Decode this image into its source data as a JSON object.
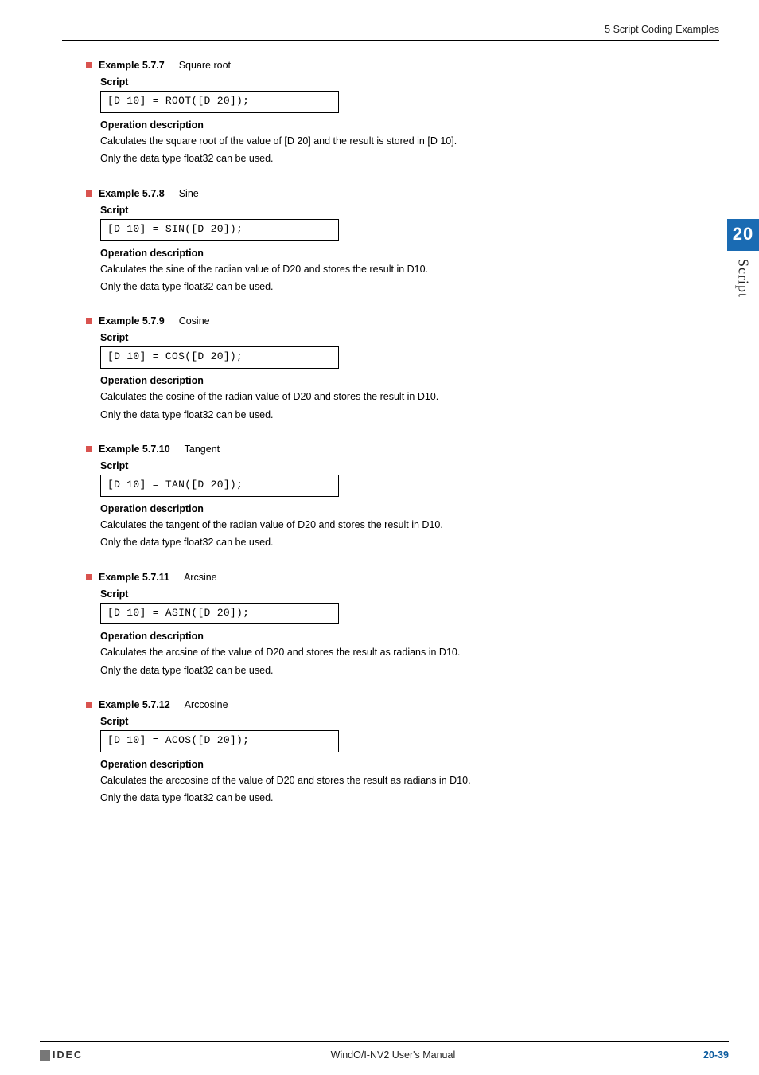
{
  "header": {
    "section": "5 Script Coding Examples"
  },
  "side": {
    "number": "20",
    "label": "Script"
  },
  "examples": [
    {
      "label": "Example 5.7.7",
      "title": "Square root",
      "script_heading": "Script",
      "script": "[D 10] = ROOT([D 20]);",
      "opdesc_heading": "Operation description",
      "desc1": "Calculates the square root of the value of [D 20] and the result is stored in [D 10].",
      "desc2": "Only the data type float32 can be used."
    },
    {
      "label": "Example 5.7.8",
      "title": "Sine",
      "script_heading": "Script",
      "script": "[D 10] = SIN([D 20]);",
      "opdesc_heading": "Operation description",
      "desc1": "Calculates the sine of the radian value of D20 and stores the result in D10.",
      "desc2": "Only the data type float32 can be used."
    },
    {
      "label": "Example 5.7.9",
      "title": "Cosine",
      "script_heading": "Script",
      "script": "[D 10] = COS([D 20]);",
      "opdesc_heading": "Operation description",
      "desc1": "Calculates the cosine of the radian value of D20 and stores the result in D10.",
      "desc2": "Only the data type float32 can be used."
    },
    {
      "label": "Example 5.7.10",
      "title": "Tangent",
      "script_heading": "Script",
      "script": "[D 10] = TAN([D 20]);",
      "opdesc_heading": "Operation description",
      "desc1": "Calculates the tangent of the radian value of D20 and stores the result in D10.",
      "desc2": "Only the data type float32 can be used."
    },
    {
      "label": "Example 5.7.11",
      "title": "Arcsine",
      "script_heading": "Script",
      "script": "[D 10] = ASIN([D 20]);",
      "opdesc_heading": "Operation description",
      "desc1": "Calculates the arcsine of the value of D20 and stores the result as radians in D10.",
      "desc2": "Only the data type float32 can be used."
    },
    {
      "label": "Example 5.7.12",
      "title": "Arccosine",
      "script_heading": "Script",
      "script": "[D 10] = ACOS([D 20]);",
      "opdesc_heading": "Operation description",
      "desc1": "Calculates the arccosine of the value of D20 and stores the result as radians in D10.",
      "desc2": "Only the data type float32 can be used."
    }
  ],
  "footer": {
    "logo": "IDEC",
    "center": "WindO/I-NV2 User's Manual",
    "page": "20-39"
  }
}
